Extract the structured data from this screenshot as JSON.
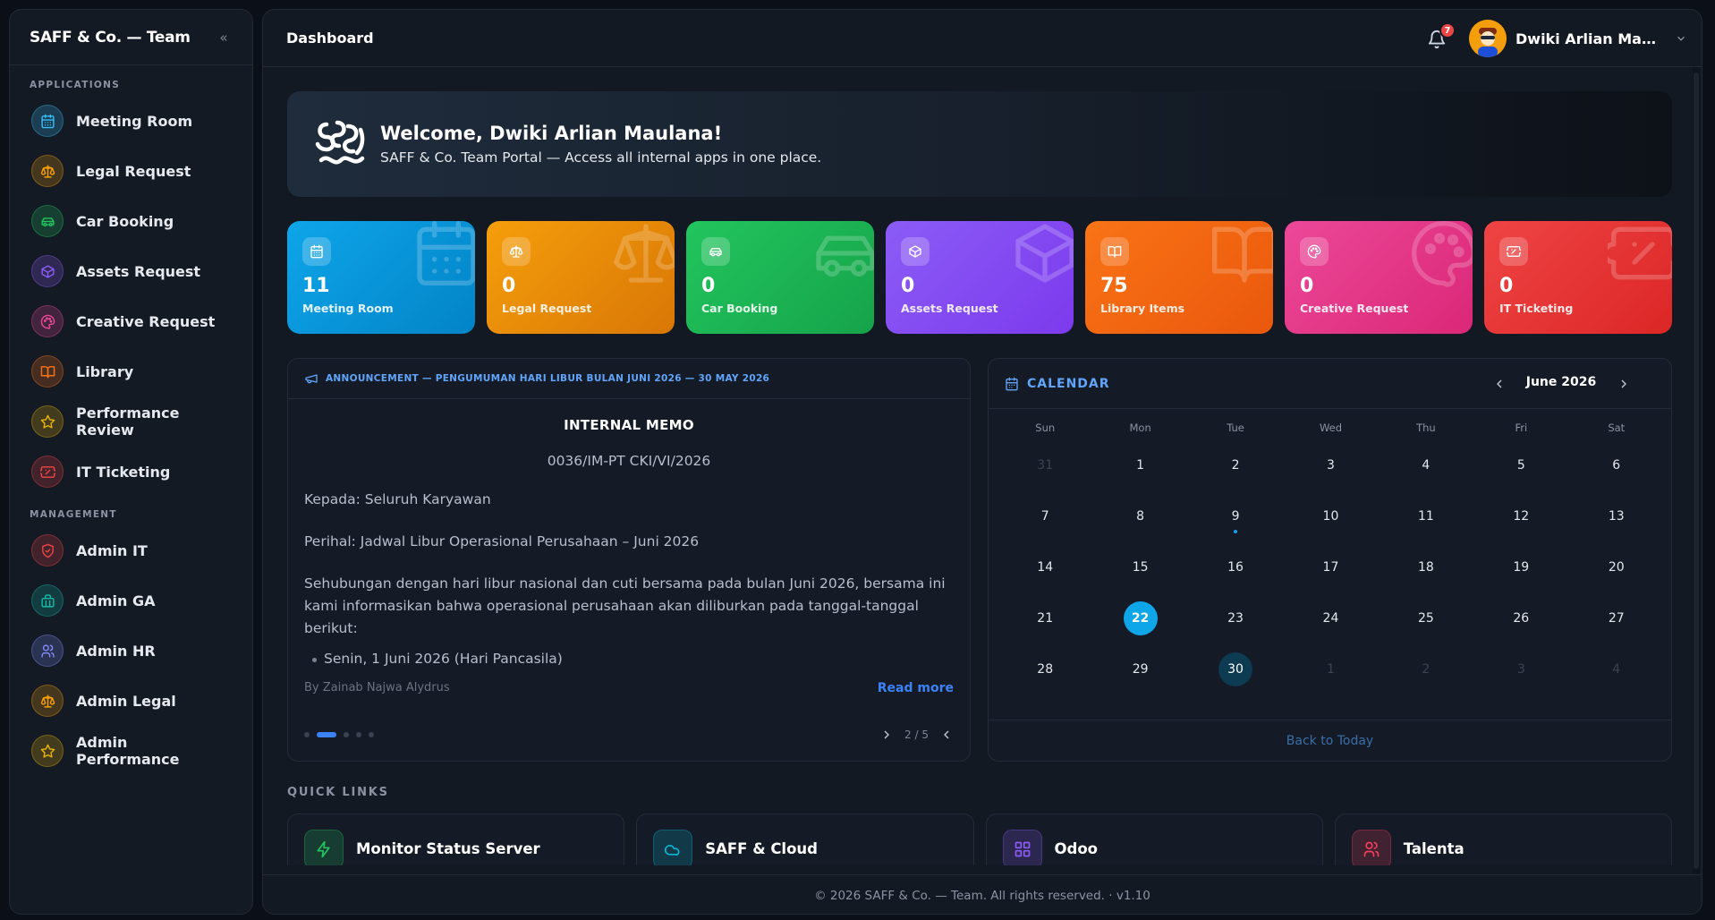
{
  "sidebar": {
    "title": "SAFF & Co. — Team",
    "collapse_icon": "chevrons-left-icon",
    "sections": [
      {
        "label": "APPLICATIONS",
        "items": [
          {
            "label": "Meeting Room",
            "icon": "calendar-icon",
            "color": "#38bdf8"
          },
          {
            "label": "Legal Request",
            "icon": "scale-icon",
            "color": "#f59e0b"
          },
          {
            "label": "Car Booking",
            "icon": "car-icon",
            "color": "#22c55e"
          },
          {
            "label": "Assets Request",
            "icon": "box-icon",
            "color": "#8b5cf6"
          },
          {
            "label": "Creative Request",
            "icon": "palette-icon",
            "color": "#ec4899"
          },
          {
            "label": "Library",
            "icon": "book-icon",
            "color": "#f97316"
          },
          {
            "label": "Performance Review",
            "icon": "star-icon",
            "color": "#eab308"
          },
          {
            "label": "IT Ticketing",
            "icon": "ticket-icon",
            "color": "#ef4444"
          }
        ]
      },
      {
        "label": "MANAGEMENT",
        "items": [
          {
            "label": "Admin IT",
            "icon": "shield-icon",
            "color": "#ef4444"
          },
          {
            "label": "Admin GA",
            "icon": "building-icon",
            "color": "#14b8a6"
          },
          {
            "label": "Admin HR",
            "icon": "users-icon",
            "color": "#818cf8"
          },
          {
            "label": "Admin Legal",
            "icon": "scale-icon",
            "color": "#f59e0b"
          },
          {
            "label": "Admin Performance",
            "icon": "star-icon",
            "color": "#eab308"
          }
        ]
      }
    ]
  },
  "header": {
    "title": "Dashboard",
    "notifications": "7",
    "user_name": "Dwiki Arlian Maula..."
  },
  "banner": {
    "title": "Welcome, Dwiki Arlian Maulana!",
    "subtitle": "SAFF & Co. Team Portal — Access all internal apps in one place."
  },
  "stats": [
    {
      "value": "11",
      "label": "Meeting Room",
      "icon": "calendar-icon",
      "color": "#0ea5e9",
      "color2": "#0284c7"
    },
    {
      "value": "0",
      "label": "Legal Request",
      "icon": "scale-icon",
      "color": "#f59e0b",
      "color2": "#d97706"
    },
    {
      "value": "0",
      "label": "Car Booking",
      "icon": "car-icon",
      "color": "#22c55e",
      "color2": "#16a34a"
    },
    {
      "value": "0",
      "label": "Assets Request",
      "icon": "box-icon",
      "color": "#8b5cf6",
      "color2": "#7c3aed"
    },
    {
      "value": "75",
      "label": "Library Items",
      "icon": "book-icon",
      "color": "#f97316",
      "color2": "#ea580c"
    },
    {
      "value": "0",
      "label": "Creative Request",
      "icon": "palette-icon",
      "color": "#ec4899",
      "color2": "#db2777"
    },
    {
      "value": "0",
      "label": "IT Ticketing",
      "icon": "ticket-icon",
      "color": "#ef4444",
      "color2": "#dc2626"
    }
  ],
  "announcement": {
    "header": "ANNOUNCEMENT — PENGUMUMAN HARI LIBUR BULAN JUNI 2026 — 30 MAY 2026",
    "memo_title": "INTERNAL MEMO",
    "memo_number": "0036/IM-PT CKI/VI/2026",
    "to": "Kepada: Seluruh Karyawan",
    "subject": "Perihal: Jadwal Libur Operasional Perusahaan – Juni 2026",
    "body": "Sehubungan dengan hari libur nasional dan cuti bersama pada bulan Juni 2026, bersama ini kami informasikan bahwa operasional perusahaan akan diliburkan pada tanggal-tanggal berikut:",
    "list_item": "Senin, 1 Juni 2026 (Hari Pancasila)",
    "author": "By Zainab Najwa Alydrus",
    "read_more": "Read more",
    "pager": "2 / 5"
  },
  "calendar": {
    "title": "CALENDAR",
    "month": "June 2026",
    "weekdays": [
      "Sun",
      "Mon",
      "Tue",
      "Wed",
      "Thu",
      "Fri",
      "Sat"
    ],
    "weeks": [
      [
        "31",
        "1",
        "2",
        "3",
        "4",
        "5",
        "6"
      ],
      [
        "7",
        "8",
        "9",
        "10",
        "11",
        "12",
        "13"
      ],
      [
        "14",
        "15",
        "16",
        "17",
        "18",
        "19",
        "20"
      ],
      [
        "21",
        "22",
        "23",
        "24",
        "25",
        "26",
        "27"
      ],
      [
        "28",
        "29",
        "30",
        "1",
        "2",
        "3",
        "4"
      ]
    ],
    "today": "22",
    "selected": "30",
    "event_day": "9",
    "back_label": "Back to Today"
  },
  "quick_links": {
    "title": "QUICK LINKS",
    "items": [
      {
        "label": "Monitor Status Server",
        "icon": "zap-icon",
        "color": "#22c55e"
      },
      {
        "label": "SAFF & Cloud",
        "icon": "cloud-icon",
        "color": "#06b6d4"
      },
      {
        "label": "Odoo",
        "icon": "grid-icon",
        "color": "#8b5cf6"
      },
      {
        "label": "Talenta",
        "icon": "users-icon",
        "color": "#f43f5e"
      }
    ]
  },
  "footer": {
    "text": "© 2026 SAFF & Co. — Team. All rights reserved.  ·  v1.10"
  }
}
